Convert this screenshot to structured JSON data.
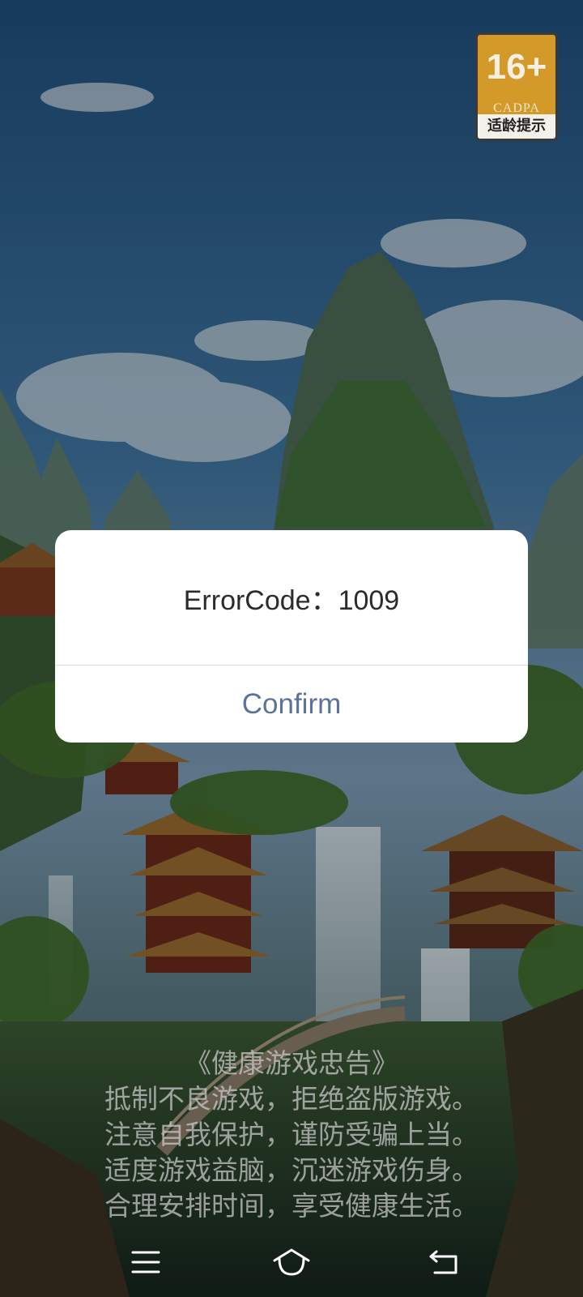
{
  "age_rating": {
    "age": "16+",
    "org": "CADPA",
    "tip": "适龄提示"
  },
  "dialog": {
    "message": "ErrorCode：1009",
    "confirm_label": "Confirm"
  },
  "health_advice": {
    "title": "《健康游戏忠告》",
    "lines": [
      "抵制不良游戏，拒绝盗版游戏。",
      "注意自我保护，谨防受骗上当。",
      "适度游戏益脑，沉迷游戏伤身。",
      "合理安排时间，享受健康生活。"
    ]
  },
  "navbar": {
    "icons": [
      "menu-icon",
      "home-icon",
      "back-icon"
    ]
  },
  "colors": {
    "dialog_bg": "#ffffff",
    "confirm_text": "#5b7399",
    "badge_bg": "#d39a2a"
  }
}
